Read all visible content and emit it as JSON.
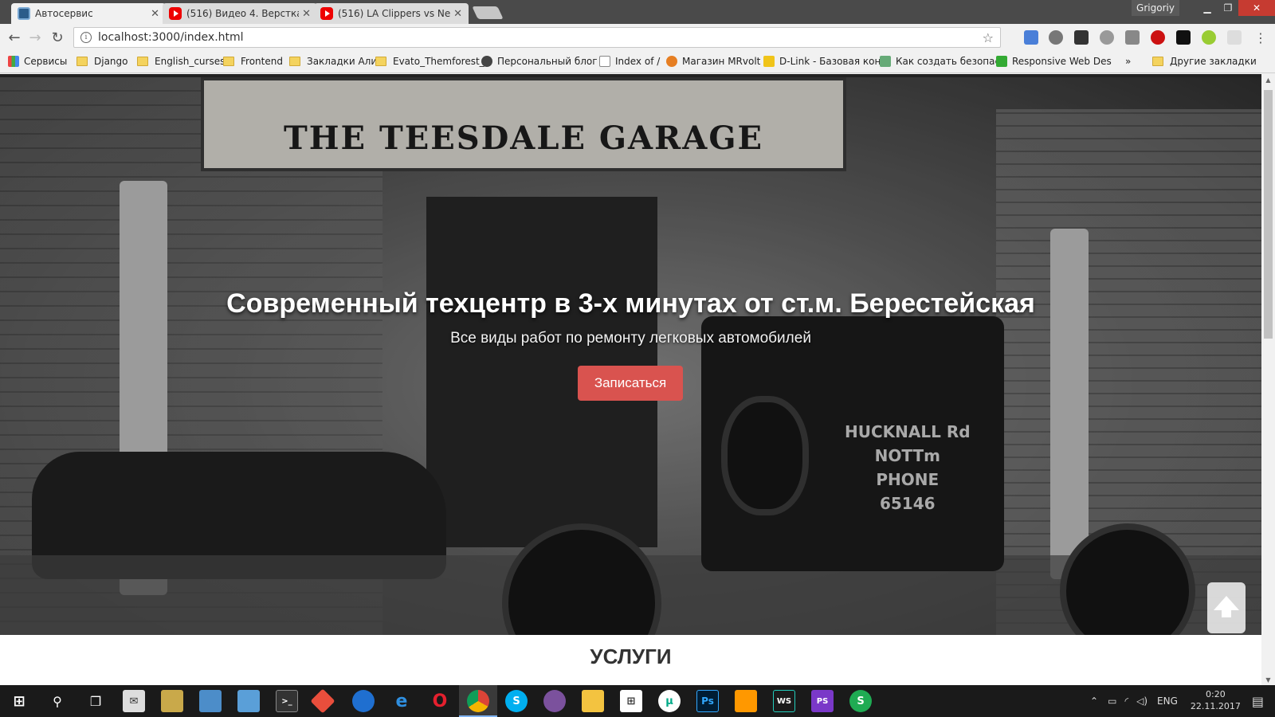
{
  "browser": {
    "tabs": [
      {
        "title": "Автосервис",
        "active": true
      },
      {
        "title": "(516) Видео 4. Верстка с",
        "active": false
      },
      {
        "title": "(516) LA Clippers vs New",
        "active": false
      }
    ],
    "user": "Grigoriy",
    "url": "localhost:3000/index.html",
    "bookmarks": [
      {
        "label": "Сервисы",
        "type": "apps"
      },
      {
        "label": "Django",
        "type": "folder"
      },
      {
        "label": "English_curses",
        "type": "folder"
      },
      {
        "label": "Frontend",
        "type": "folder"
      },
      {
        "label": "Закладки Али",
        "type": "folder"
      },
      {
        "label": "Evato_Themforest_",
        "type": "folder"
      },
      {
        "label": "Персональный блог",
        "type": "site"
      },
      {
        "label": "Index of /",
        "type": "page"
      },
      {
        "label": "Магазин MRvolt",
        "type": "site"
      },
      {
        "label": "D-Link - Базовая кон",
        "type": "site"
      },
      {
        "label": "Как создать безопас",
        "type": "site"
      },
      {
        "label": "Responsive Web Des",
        "type": "site"
      },
      {
        "label": "»",
        "type": "more"
      },
      {
        "label": "Другие закладки",
        "type": "folder"
      }
    ]
  },
  "hero": {
    "sign_text": "THE TEESDALE GARAGE",
    "truck_text": [
      "HUCKNALL Rd",
      "NOTTm",
      "PHONE",
      "65146"
    ],
    "title": "Современный техцентр в 3-х минутах от ст.м. Берестейская",
    "subtitle": "Все виды работ по ремонту легковых автомобилей",
    "button_label": "Записаться"
  },
  "services_heading": "УСЛУГИ",
  "taskbar": {
    "language": "ENG",
    "time": "0:20",
    "date": "22.11.2017"
  },
  "colors": {
    "accent_button": "#d9534f",
    "taskbar": "#1a1a1a",
    "chrome": "#f1f1f1"
  }
}
